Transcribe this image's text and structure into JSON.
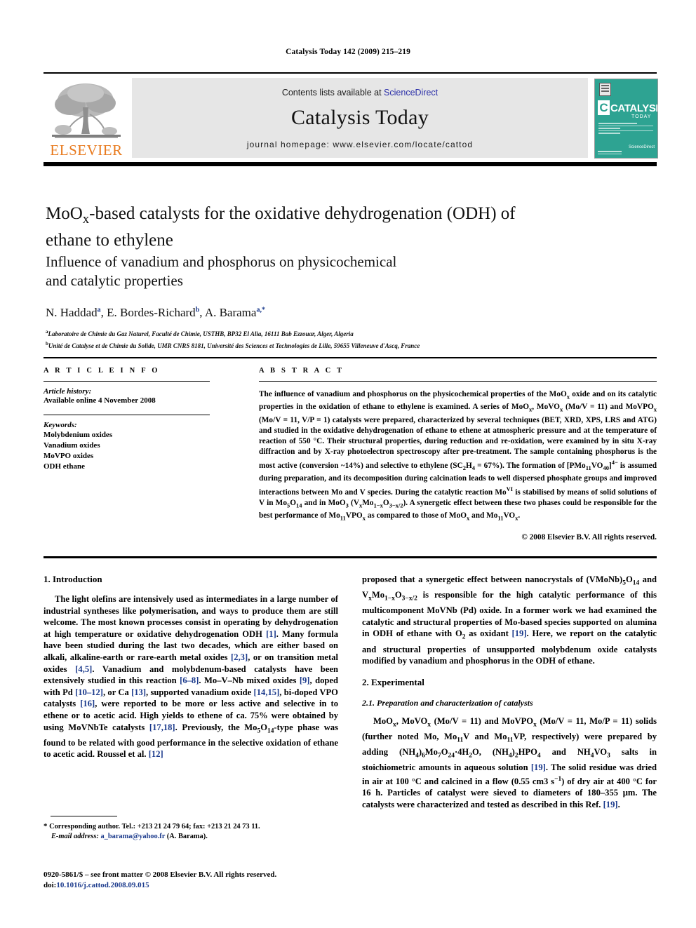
{
  "running_head": "Catalysis Today 142 (2009) 215–219",
  "masthead": {
    "contents_prefix": "Contents lists available at ",
    "sciencedirect": "ScienceDirect",
    "journal_title": "Catalysis Today",
    "homepage": "journal homepage: www.elsevier.com/locate/cattod",
    "publisher_wordmark": "ELSEVIER",
    "cover": {
      "title": "CATALYSIS",
      "initial": "C",
      "subtitle": "TODAY",
      "sciencedirect_badge": "ScienceDirect",
      "bg_color": "#2ea392"
    }
  },
  "article": {
    "title": "MoOx-based catalysts for the oxidative dehydrogenation (ODH) of ethane to ethylene",
    "title_line1_pre": "MoO",
    "title_line1_sub": "x",
    "title_line1_post": "-based catalysts for the oxidative dehydrogenation (ODH) of",
    "title_line2": "ethane to ethylene",
    "subtitle_line1": "Influence of vanadium and phosphorus on physicochemical",
    "subtitle_line2": "and catalytic properties",
    "authors": [
      {
        "name": "N. Haddad",
        "marks": "a"
      },
      {
        "name": "E. Bordes-Richard",
        "marks": "b"
      },
      {
        "name": "A. Barama",
        "marks": "a,*"
      }
    ],
    "affiliations": [
      {
        "mark": "a",
        "text": "Laboratoire de Chimie du Gaz Naturel, Faculté de Chimie, USTHB, BP32 El Alia, 16111 Bab Ezzouar, Alger, Algeria"
      },
      {
        "mark": "b",
        "text": "Unité de Catalyse et de Chimie du Solide, UMR CNRS 8181, Université des Sciences et Technologies de Lille, 59655 Villeneuve d'Ascq, France"
      }
    ]
  },
  "article_info": {
    "heading": "A R T I C L E  I N F O",
    "history_label": "Article history:",
    "history_value": "Available online 4 November 2008",
    "keywords_label": "Keywords:",
    "keywords": [
      "Molybdenium oxides",
      "Vanadium oxides",
      "MoVPO oxides",
      "ODH ethane"
    ]
  },
  "abstract": {
    "heading": "A B S T R A C T",
    "paragraph_parts": [
      "The influence of vanadium and phosphorus on the physicochemical properties of the MoO",
      "x",
      " oxide and on its catalytic properties in the oxidation of ethane to ethylene is examined. A series of MoO",
      "x",
      ", MoVO",
      "x",
      " (Mo/V = 11) and MoVPO",
      "x",
      " (Mo/V = 11, V/P = 1) catalysts were prepared, characterized by several techniques (BET, XRD, XPS, LRS and ATG) and studied in the oxidative dehydrogenation of ethane to ethene at atmospheric pressure and at the temperature of reaction of 550 °C. Their structural properties, during reduction and re-oxidation, were examined by in situ X-ray diffraction and by X-ray photoelectron spectroscopy after pre-treatment. The sample containing phosphorus is the most active (conversion ~14%) and selective to ethylene (SC",
      "2",
      "H",
      "4",
      " = 67%). The formation of [PMo",
      "11",
      "VO",
      "40",
      "]",
      "4−",
      " is assumed during preparation, and its decomposition during calcination leads to well dispersed phosphate groups and improved interactions between Mo and V species. During the catalytic reaction Mo",
      "VI",
      " is stabilised by means of solid solutions of V in Mo",
      "5",
      "O",
      "14",
      " and in MoO",
      "3",
      " (V",
      "x",
      "Mo",
      "1−x",
      "O",
      "3−x/2",
      "). A synergetic effect between these two phases could be responsible for the best performance of Mo",
      "11",
      "VPO",
      "x",
      " as compared to those of MoO",
      "x",
      " and Mo",
      "11",
      "VO",
      "x",
      "."
    ],
    "copyright": "© 2008 Elsevier B.V. All rights reserved."
  },
  "sections": {
    "introduction_heading": "1. Introduction",
    "experimental_heading": "2. Experimental",
    "subsection_2_1": "2.1. Preparation and characterization of catalysts"
  },
  "body": {
    "intro_p1": "The light olefins are intensively used as intermediates in a large number of industrial syntheses like polymerisation, and ways to produce them are still welcome. The most known processes consist in operating by dehydrogenation at high temperature or oxidative dehydrogenation ODH [1]. Many formula have been studied during the last two decades, which are either based on alkali, alkaline-earth or rare-earth metal oxides [2,3], or on transition metal oxides [4,5]. Vanadium and molybdenum-based catalysts have been extensively studied in this reaction [6–8]. Mo–V–Nb mixed oxides [9], doped with Pd [10–12], or Ca [13], supported vanadium oxide [14,15], bi-doped VPO catalysts [16], were reported to be more or less active and selective in to ethene or to acetic acid. High yields to ethene of ca. 75% were obtained by using MoVNbTe catalysts [17,18]. Previously, the Mo5O14-type phase was found to be related with good performance in the selective oxidation of ethane to acetic acid. Roussel et al. [12]",
    "intro_p2": "proposed that a synergetic effect between nanocrystals of (VMoNb)5O14 and VxMo1−xO3−x/2 is responsible for the high catalytic performance of this multicomponent MoVNb (Pd) oxide. In a former work we had examined the catalytic and structural properties of Mo-based species supported on alumina in ODH of ethane with O2 as oxidant [19]. Here, we report on the catalytic and structural properties of unsupported molybdenum oxide catalysts modified by vanadium and phosphorus in the ODH of ethane.",
    "exp_p1": "MoOx, MoVOx (Mo/V = 11) and MoVPOx (Mo/V = 11, Mo/P = 11) solids (further noted Mo, Mo11V and Mo11VP, respectively) were prepared by adding (NH4)6Mo7O24·4H2O, (NH4)2HPO4 and NH4VO3 salts in stoichiometric amounts in aqueous solution [19]. The solid residue was dried in air at 100 °C and calcined in a flow (0.55 cm3 s−1) of dry air at 400 °C for 16 h. Particles of catalyst were sieved to diameters of 180–355 μm. The catalysts were characterized and tested as described in this Ref. [19]."
  },
  "footnote": {
    "star": "*",
    "corresponding": "Corresponding author. Tel.: +213 21 24 79 64; fax: +213 21 24 73 11.",
    "email_label": "E-mail address:",
    "email": "a_barama@yahoo.fr",
    "email_owner": "(A. Barama)."
  },
  "imprint": {
    "issn_line": "0920-5861/$ – see front matter © 2008 Elsevier B.V. All rights reserved.",
    "doi_label": "doi:",
    "doi_value": "10.1016/j.cattod.2008.09.015"
  }
}
